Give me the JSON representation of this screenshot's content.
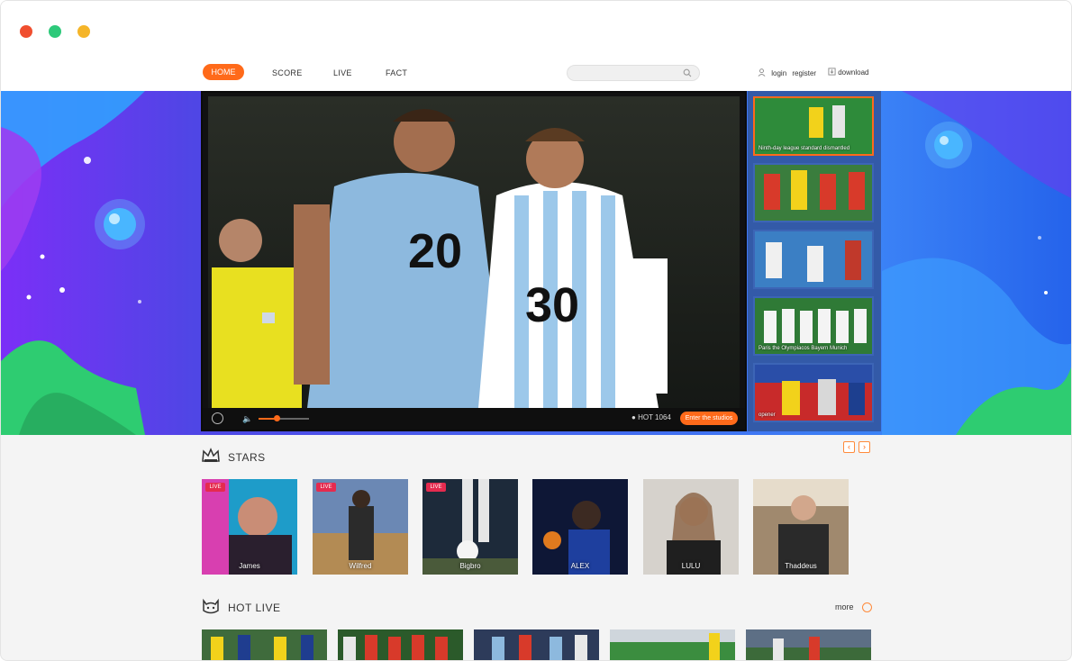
{
  "window": {
    "controls": [
      "close",
      "minimize",
      "maximize"
    ]
  },
  "nav": {
    "items": [
      "HOME",
      "SCORE",
      "LIVE",
      "FACT"
    ],
    "login": "login",
    "register": "register",
    "download": "download"
  },
  "player": {
    "hot_label": "HOT 1064",
    "enter_label": "Enter the studios",
    "volume_level": 0.35
  },
  "side_thumbs": [
    {
      "caption": "Ninth-day league standard dismantled"
    },
    {
      "caption": ""
    },
    {
      "caption": ""
    },
    {
      "caption": "Paris the Olympiacos Bayern Munich"
    },
    {
      "caption": "opener"
    }
  ],
  "stars": {
    "title": "STARS",
    "prev": "‹",
    "next": "›",
    "items": [
      {
        "name": "James",
        "live": "LIVE"
      },
      {
        "name": "Wilfred",
        "live": "LIVE"
      },
      {
        "name": "Bigbro",
        "live": "LIVE"
      },
      {
        "name": "ALEX",
        "live": ""
      },
      {
        "name": "LULU",
        "live": ""
      },
      {
        "name": "Thaddeus",
        "live": ""
      }
    ]
  },
  "hot_live": {
    "title": "HOT LIVE",
    "more": "more"
  },
  "colors": {
    "accent": "#ff6a1a",
    "thumb_panel": "#335aa8",
    "live_tag": "#e52b4f"
  }
}
